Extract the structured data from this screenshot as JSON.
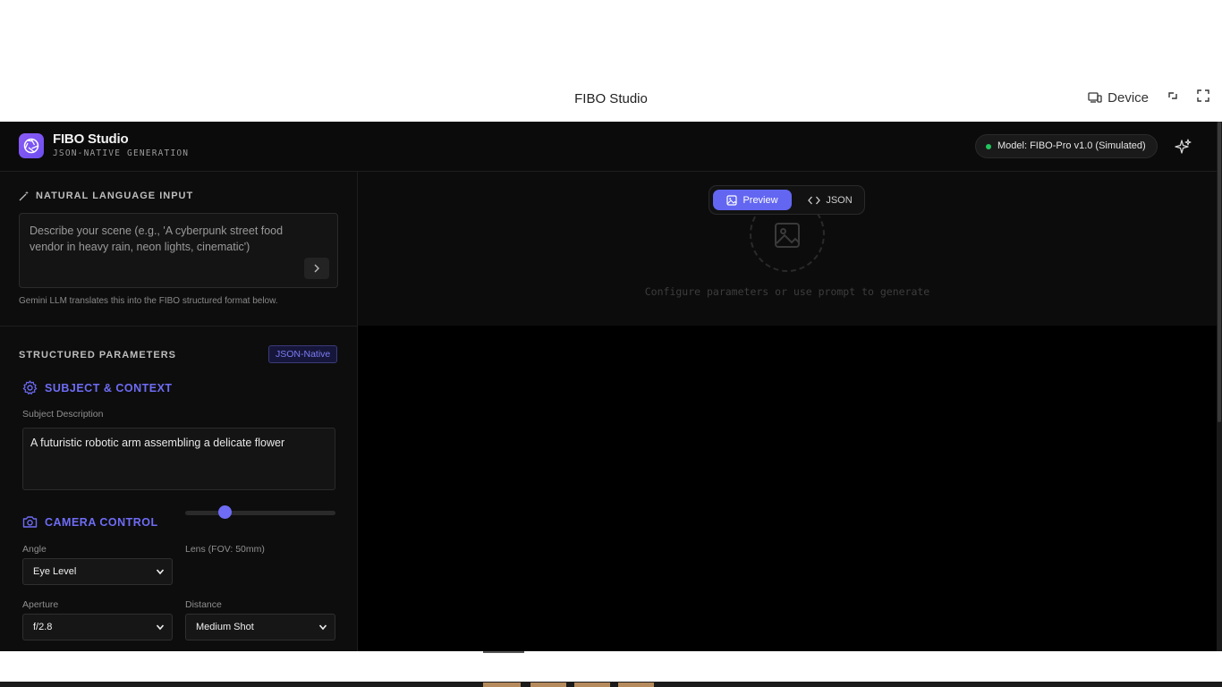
{
  "window": {
    "title": "FIBO Studio",
    "device_label": "Device"
  },
  "header": {
    "brand_title": "FIBO Studio",
    "brand_subtitle": "JSON-NATIVE GENERATION",
    "model_badge": "Model: FIBO-Pro v1.0 (Simulated)",
    "status_color": "#22c55e"
  },
  "natural_language": {
    "section_label": "NATURAL LANGUAGE INPUT",
    "placeholder": "Describe your scene (e.g., 'A cyberpunk street food vendor in heavy rain, neon lights, cinematic')",
    "hint": "Gemini LLM translates this into the FIBO structured format below."
  },
  "structured": {
    "section_label": "STRUCTURED PARAMETERS",
    "badge": "JSON-Native",
    "subject": {
      "title": "SUBJECT & CONTEXT",
      "description_label": "Subject Description",
      "description_value": "A futuristic robotic arm assembling a delicate flower"
    },
    "camera": {
      "title": "CAMERA CONTROL",
      "angle_label": "Angle",
      "angle_value": "Eye Level",
      "lens_label": "Lens (FOV: 50mm)",
      "lens_slider_fraction": 0.24,
      "aperture_label": "Aperture",
      "aperture_value": "f/2.8",
      "distance_label": "Distance",
      "distance_value": "Medium Shot"
    }
  },
  "preview": {
    "tab_preview": "Preview",
    "tab_json": "JSON",
    "empty_message": "Configure parameters or use prompt to generate"
  },
  "theme": {
    "accent": "#6366f1",
    "background": "#0a0a0a"
  }
}
